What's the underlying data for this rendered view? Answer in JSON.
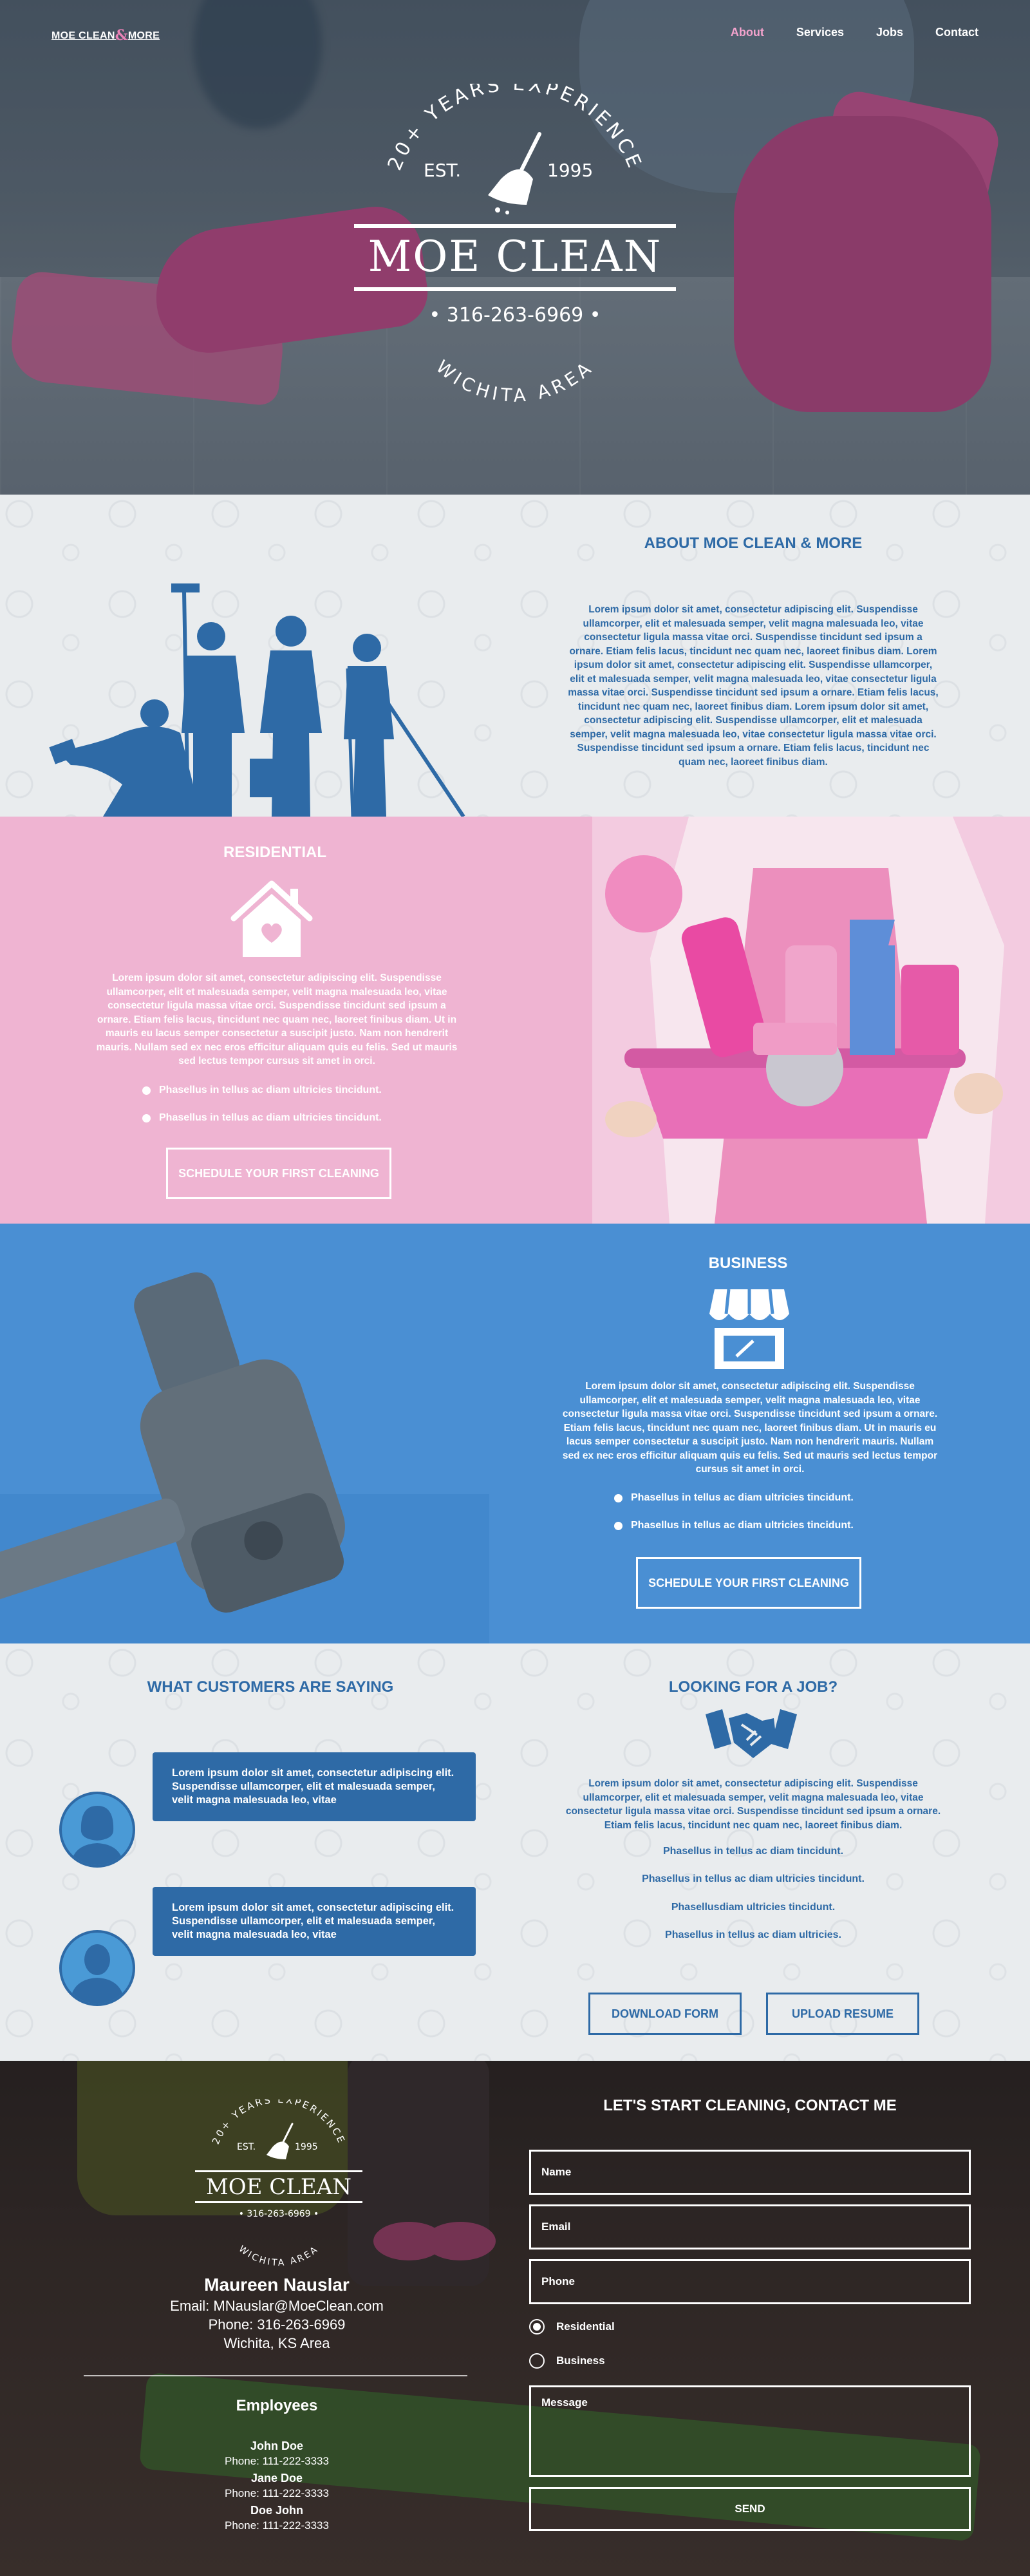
{
  "nav": {
    "logo": "MOE CLEAN",
    "logo_amp": "&",
    "logo_end": "MORE",
    "items": [
      {
        "label": "About",
        "active": true
      },
      {
        "label": "Services",
        "active": false
      },
      {
        "label": "Jobs",
        "active": false
      },
      {
        "label": "Contact",
        "active": false
      }
    ]
  },
  "hero": {
    "arc_top": "20+ YEARS EXPERIENCE",
    "est": "EST.",
    "year": "1995",
    "title": "MOE CLEAN",
    "phone": "• 316-263-6969 •",
    "arc_bottom": "WICHITA AREA"
  },
  "about": {
    "heading": "ABOUT MOE CLEAN & MORE",
    "body": "Lorem ipsum dolor sit amet, consectetur adipiscing elit. Suspendisse ullamcorper, elit et malesuada semper, velit magna malesuada leo, vitae consectetur ligula massa vitae orci. Suspendisse tincidunt sed ipsum a ornare. Etiam felis lacus, tincidunt nec quam nec, laoreet finibus diam. Lorem ipsum dolor sit amet, consectetur adipiscing elit. Suspendisse ullamcorper, elit et malesuada semper, velit magna malesuada leo, vitae consectetur ligula massa vitae orci. Suspendisse tincidunt sed ipsum a ornare. Etiam felis lacus, tincidunt nec quam nec, laoreet finibus diam. Lorem ipsum dolor sit amet, consectetur adipiscing elit. Suspendisse ullamcorper, elit et malesuada semper, velit magna malesuada leo, vitae consectetur ligula massa vitae orci. Suspendisse tincidunt sed ipsum a ornare. Etiam felis lacus, tincidunt nec quam nec, laoreet finibus diam."
  },
  "residential": {
    "heading": "RESIDENTIAL",
    "icon": "house-heart-icon",
    "body": "Lorem ipsum dolor sit amet, consectetur adipiscing elit. Suspendisse ullamcorper, elit et malesuada semper, velit magna malesuada leo, vitae consectetur ligula massa vitae orci. Suspendisse tincidunt sed ipsum a ornare. Etiam felis lacus, tincidunt nec quam nec, laoreet finibus diam. Ut in mauris eu lacus semper consectetur a suscipit justo. Nam non hendrerit mauris. Nullam sed ex nec eros efficitur aliquam quis eu felis. Sed ut mauris sed lectus tempor cursus sit amet in orci.",
    "bullets": [
      "Phasellus in tellus ac diam ultricies tincidunt.",
      "Phasellus in tellus ac diam ultricies tincidunt."
    ],
    "button": "SCHEDULE YOUR FIRST CLEANING"
  },
  "business": {
    "heading": "BUSINESS",
    "icon": "storefront-icon",
    "body": "Lorem ipsum dolor sit amet, consectetur adipiscing elit. Suspendisse ullamcorper, elit et malesuada semper, velit magna malesuada leo, vitae consectetur ligula massa vitae orci. Suspendisse tincidunt sed ipsum a ornare. Etiam felis lacus, tincidunt nec quam nec, laoreet finibus diam. Ut in mauris eu lacus semper consectetur a suscipit justo. Nam non hendrerit mauris. Nullam sed ex nec eros efficitur aliquam quis eu felis. Sed ut mauris sed lectus tempor cursus sit amet in orci.",
    "bullets": [
      "Phasellus in tellus ac diam ultricies tincidunt.",
      "Phasellus in tellus ac diam ultricies tincidunt."
    ],
    "button": "SCHEDULE YOUR FIRST CLEANING"
  },
  "testimonials": {
    "heading": "WHAT CUSTOMERS ARE SAYING",
    "quotes": [
      {
        "text": "Lorem ipsum dolor sit amet, consectetur adipiscing elit. Suspendisse ullamcorper, elit et malesuada semper, velit magna malesuada leo, vitae"
      },
      {
        "text": "Lorem ipsum dolor sit amet, consectetur adipiscing elit. Suspendisse ullamcorper, elit et malesuada semper, velit magna malesuada leo, vitae"
      }
    ]
  },
  "jobs": {
    "heading": "LOOKING FOR A JOB?",
    "icon": "handshake-icon",
    "body": "Lorem ipsum dolor sit amet, consectetur adipiscing elit. Suspendisse ullamcorper, elit et malesuada semper, velit magna malesuada leo, vitae consectetur ligula massa vitae orci. Suspendisse tincidunt sed ipsum a ornare. Etiam felis lacus, tincidunt nec quam nec, laoreet finibus diam.",
    "lines": [
      "Phasellus in tellus ac diam  tincidunt.",
      "Phasellus in tellus ac diam ultricies tincidunt.",
      "Phasellusdiam ultricies tincidunt.",
      "Phasellus in tellus ac diam ultricies."
    ],
    "download_button": "DOWNLOAD FORM",
    "upload_button": "UPLOAD RESUME"
  },
  "contact": {
    "badge_arc_top": "20+ YEARS EXPERIENCE",
    "badge_est": "EST.",
    "badge_year": "1995",
    "badge_title": "MOE CLEAN",
    "badge_phone": "• 316-263-6969 •",
    "badge_arc_bottom": "WICHITA AREA",
    "owner_name": "Maureen Nauslar",
    "owner_email": "Email: MNauslar@MoeClean.com",
    "owner_phone": "Phone: 316-263-6969",
    "owner_location": "Wichita, KS Area",
    "employees_heading": "Employees",
    "employees": [
      {
        "name": "John Doe",
        "phone": "Phone: 111-222-3333"
      },
      {
        "name": "Jane Doe",
        "phone": "Phone: 111-222-3333"
      },
      {
        "name": "Doe John",
        "phone": "Phone: 111-222-3333"
      }
    ],
    "form_heading": "LET'S START CLEANING, CONTACT ME",
    "name_placeholder": "Name",
    "email_placeholder": "Email",
    "phone_placeholder": "Phone",
    "radio_residential": "Residential",
    "radio_business": "Business",
    "residential_selected": true,
    "message_placeholder": "Message",
    "send": "SEND"
  },
  "colors": {
    "blue": "#2e6aa6",
    "pink": "#efb4d2",
    "business_blue": "#4a8fd3",
    "light_bg": "#e9ecee",
    "nav_active": "#f4a3cd"
  }
}
